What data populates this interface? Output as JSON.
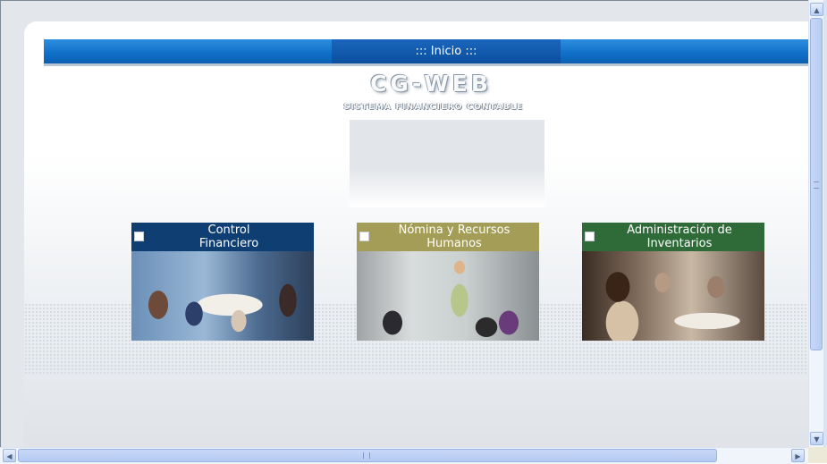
{
  "header": {
    "title": "::: Inicio :::"
  },
  "logo": {
    "title": "CG-WEB",
    "subtitle": "SISTEMA FINANCIERO CONTABLE"
  },
  "modules": [
    {
      "label": "Control\nFinanciero",
      "color": "#0f3e73"
    },
    {
      "label": "Nómina y Recursos\nHumanos",
      "color": "#a39d58"
    },
    {
      "label": "Administración de\nInventarios",
      "color": "#2e6b38"
    }
  ],
  "scrollbars": {
    "vertical": {
      "up_icon": "triangle-up-icon",
      "down_icon": "triangle-down-icon"
    },
    "horizontal": {
      "left_icon": "triangle-left-icon",
      "right_icon": "triangle-right-icon"
    }
  },
  "colors": {
    "header_blue": "#0f6fc8"
  }
}
